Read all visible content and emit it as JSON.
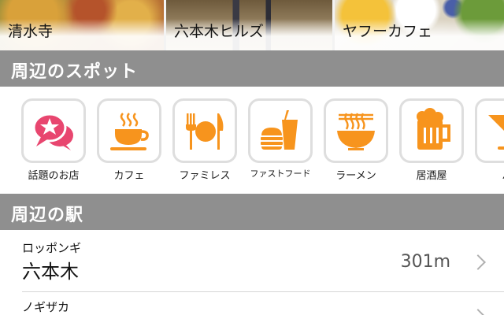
{
  "top_cards": [
    {
      "label": "清水寺",
      "photo": "kiyomizu-temple-autumn-photo"
    },
    {
      "label": "六本木ヒルズ",
      "photo": "roppongi-hills-building-photo"
    },
    {
      "label": "ヤフーカフェ",
      "photo": "cafe-food-photo"
    }
  ],
  "spots_section": {
    "title": "周辺のスポット",
    "categories": [
      {
        "label": "話題のお店",
        "icon": "trending-chat-star-icon"
      },
      {
        "label": "カフェ",
        "icon": "coffee-cup-icon"
      },
      {
        "label": "ファミレス",
        "icon": "fork-plate-knife-icon"
      },
      {
        "label": "ファストフード",
        "icon": "burger-drink-icon"
      },
      {
        "label": "ラーメン",
        "icon": "ramen-bowl-icon"
      },
      {
        "label": "居酒屋",
        "icon": "beer-mug-icon"
      },
      {
        "label": "バ",
        "icon": "cocktail-glass-icon"
      }
    ]
  },
  "stations_section": {
    "title": "周辺の駅",
    "stations": [
      {
        "furigana": "ロッポンギ",
        "name": "六本木",
        "distance": "301m"
      },
      {
        "furigana": "ノギザカ",
        "name": "",
        "distance": ""
      }
    ]
  },
  "colors": {
    "accent": "#f7941d",
    "pink": "#e8466f",
    "header_bg": "#8f8f8f"
  }
}
